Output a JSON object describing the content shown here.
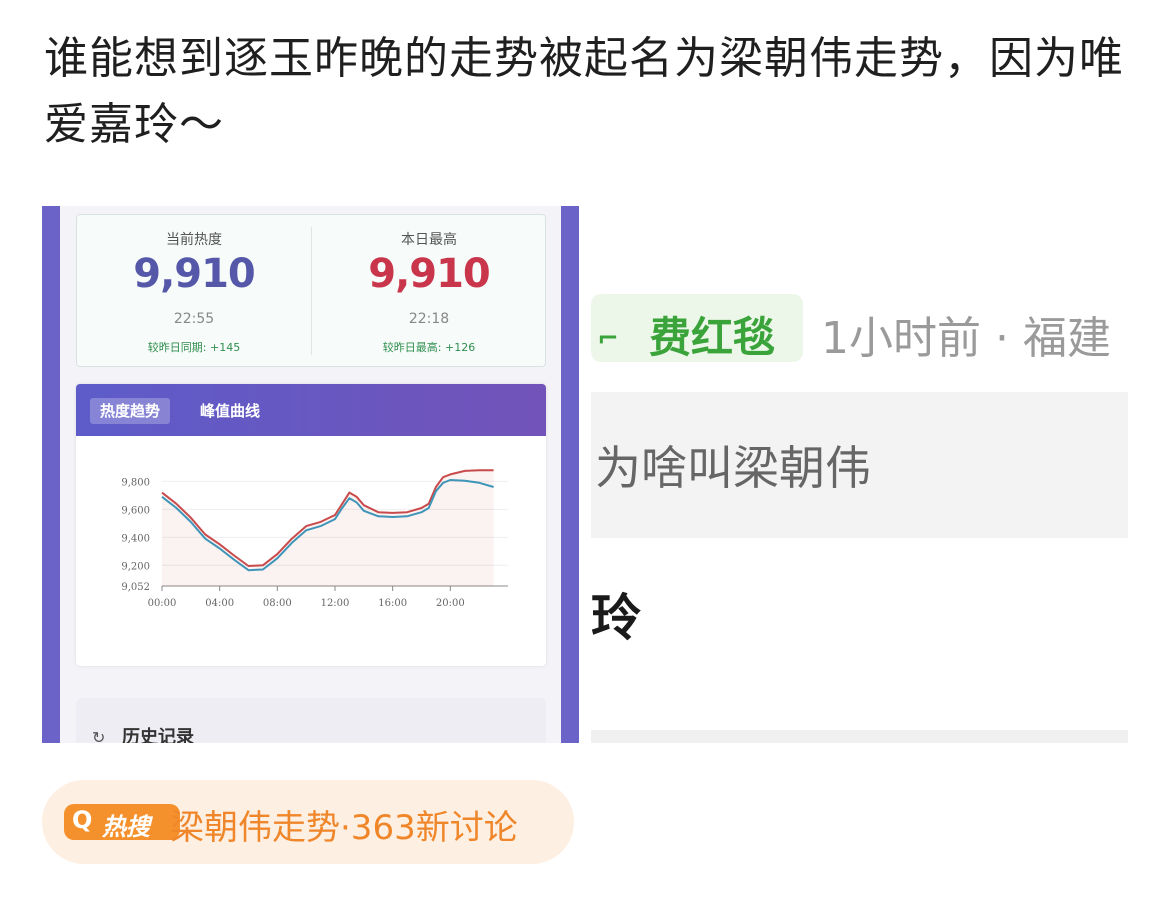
{
  "post": {
    "text": "谁能想到逐玉昨晚的走势被起名为梁朝伟走势，因为唯爱嘉玲～"
  },
  "left_screenshot": {
    "current": {
      "label": "当前热度",
      "value": "9,910",
      "time": "22:55",
      "compare": "较昨日同期: +145"
    },
    "peak": {
      "label": "本日最高",
      "value": "9,910",
      "time": "22:18",
      "compare": "较昨日最高: +126"
    },
    "tabs": [
      "热度趋势",
      "峰值曲线"
    ],
    "history_label": "历史记录",
    "colors": {
      "frame": "#6c63c9",
      "current_value": "#5558a8",
      "peak_value": "#c9354a",
      "series_red": "#c94a4a",
      "series_blue": "#3f95b8"
    }
  },
  "chart_data": {
    "type": "line",
    "title": "",
    "xlabel": "",
    "ylabel": "",
    "x_ticks": [
      "00:00",
      "04:00",
      "08:00",
      "12:00",
      "16:00",
      "20:00"
    ],
    "y_ticks": [
      "9,052",
      "9,200",
      "9,400",
      "9,600",
      "9,800"
    ],
    "ylim": [
      9052,
      9910
    ],
    "xlim": [
      0,
      24
    ],
    "grid": true,
    "series": [
      {
        "color": "#c94a4a",
        "x": [
          0,
          1,
          2,
          2.5,
          3,
          4,
          5,
          6,
          7,
          8,
          9,
          10,
          11,
          12,
          12.5,
          13,
          13.5,
          14,
          15,
          16,
          17,
          18,
          18.5,
          19,
          19.5,
          20,
          21,
          22,
          23
        ],
        "y": [
          9720,
          9640,
          9540,
          9480,
          9420,
          9350,
          9270,
          9195,
          9200,
          9280,
          9390,
          9480,
          9510,
          9560,
          9640,
          9720,
          9690,
          9630,
          9580,
          9575,
          9580,
          9610,
          9640,
          9760,
          9830,
          9850,
          9875,
          9880,
          9880
        ]
      },
      {
        "color": "#3f95b8",
        "x": [
          0,
          1,
          2,
          2.5,
          3,
          4,
          5,
          6,
          7,
          8,
          9,
          10,
          11,
          12,
          12.5,
          13,
          13.5,
          14,
          15,
          16,
          17,
          18,
          18.5,
          19,
          19.5,
          20,
          21,
          22,
          23
        ],
        "y": [
          9690,
          9610,
          9510,
          9450,
          9390,
          9320,
          9240,
          9165,
          9170,
          9250,
          9360,
          9450,
          9480,
          9530,
          9610,
          9680,
          9650,
          9590,
          9550,
          9545,
          9550,
          9580,
          9610,
          9730,
          9790,
          9810,
          9805,
          9790,
          9760
        ]
      }
    ]
  },
  "right_screenshot": {
    "tag": "费红毯",
    "tag_corner": "⌐",
    "meta": "1小时前 · 福建",
    "quote": "为啥叫梁朝伟",
    "big_char": "玲",
    "colors": {
      "tag": "#3aa33a"
    }
  },
  "hot_search": {
    "icon": "Q",
    "badge": "热搜",
    "title": "梁朝伟走势·363新讨论",
    "colors": {
      "badge_bg": "#f5912c",
      "pill_bg": "#fdefe2",
      "text": "#f0862a"
    }
  }
}
